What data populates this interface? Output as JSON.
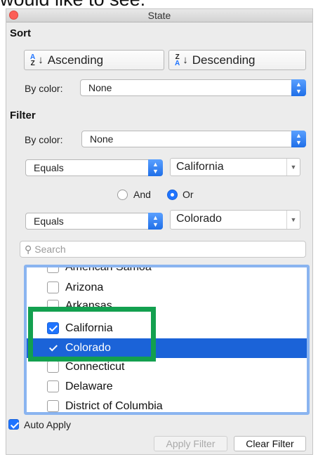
{
  "caption_text": "would like to see:",
  "window": {
    "title": "State"
  },
  "sort": {
    "heading": "Sort",
    "ascending_label": "Ascending",
    "descending_label": "Descending",
    "by_color_label": "By color:",
    "by_color_value": "None"
  },
  "filter": {
    "heading": "Filter",
    "by_color_label": "By color:",
    "by_color_value": "None",
    "condition1": {
      "operator": "Equals",
      "value": "California"
    },
    "logic": {
      "and_label": "And",
      "or_label": "Or",
      "selected": "Or"
    },
    "condition2": {
      "operator": "Equals",
      "value": "Colorado"
    },
    "search_placeholder": "Search",
    "items": [
      {
        "label": "American Samoa",
        "checked": false,
        "selected": false
      },
      {
        "label": "Arizona",
        "checked": false,
        "selected": false
      },
      {
        "label": "Arkansas",
        "checked": false,
        "selected": false
      },
      {
        "label": "California",
        "checked": true,
        "selected": false
      },
      {
        "label": "Colorado",
        "checked": true,
        "selected": true
      },
      {
        "label": "Connecticut",
        "checked": false,
        "selected": false
      },
      {
        "label": "Delaware",
        "checked": false,
        "selected": false
      },
      {
        "label": "District of Columbia",
        "checked": false,
        "selected": false
      }
    ]
  },
  "footer": {
    "auto_apply_label": "Auto Apply",
    "auto_apply_checked": true,
    "apply_filter_label": "Apply Filter",
    "clear_filter_label": "Clear Filter"
  },
  "colors": {
    "accent": "#1f74ff",
    "selection": "#1b63d8",
    "annotation_box": "#13a04f",
    "close_button": "#fc5f57"
  }
}
